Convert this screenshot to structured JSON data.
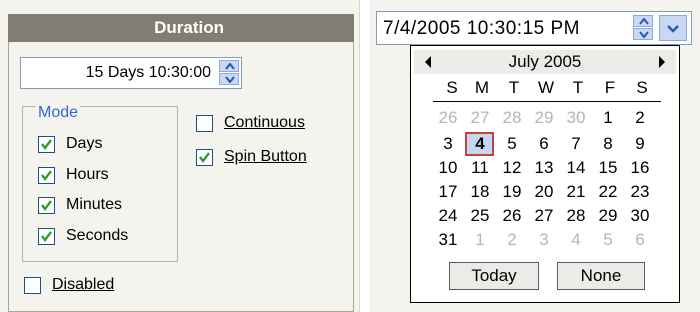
{
  "duration": {
    "header": "Duration",
    "value": "15 Days 10:30:00",
    "mode_legend": "Mode",
    "modes": [
      {
        "label": "Days",
        "checked": true
      },
      {
        "label": "Hours",
        "checked": true
      },
      {
        "label": "Minutes",
        "checked": true
      },
      {
        "label": "Seconds",
        "checked": true
      }
    ],
    "continuous": {
      "label": "Continuous",
      "checked": false
    },
    "spin_button": {
      "label": "Spin Button",
      "checked": true
    },
    "disabled": {
      "label": "Disabled",
      "checked": false
    }
  },
  "datetime": {
    "value": "7/4/2005 10:30:15 PM",
    "calendar": {
      "title": "July 2005",
      "weekdays": [
        "S",
        "M",
        "T",
        "W",
        "T",
        "F",
        "S"
      ],
      "weeks": [
        [
          "26",
          "27",
          "28",
          "29",
          "30",
          "1",
          "2"
        ],
        [
          "3",
          "4",
          "5",
          "6",
          "7",
          "8",
          "9"
        ],
        [
          "10",
          "11",
          "12",
          "13",
          "14",
          "15",
          "16"
        ],
        [
          "17",
          "18",
          "19",
          "20",
          "21",
          "22",
          "23"
        ],
        [
          "24",
          "25",
          "26",
          "27",
          "28",
          "29",
          "30"
        ],
        [
          "31",
          "1",
          "2",
          "3",
          "4",
          "5",
          "6"
        ]
      ],
      "selected_day": "4",
      "today_label": "Today",
      "none_label": "None"
    }
  },
  "colors": {
    "header_bg": "#807d73",
    "accent_blue": "#3566d6",
    "check_green": "#2f9e2f",
    "selected_border": "#c8423b"
  }
}
